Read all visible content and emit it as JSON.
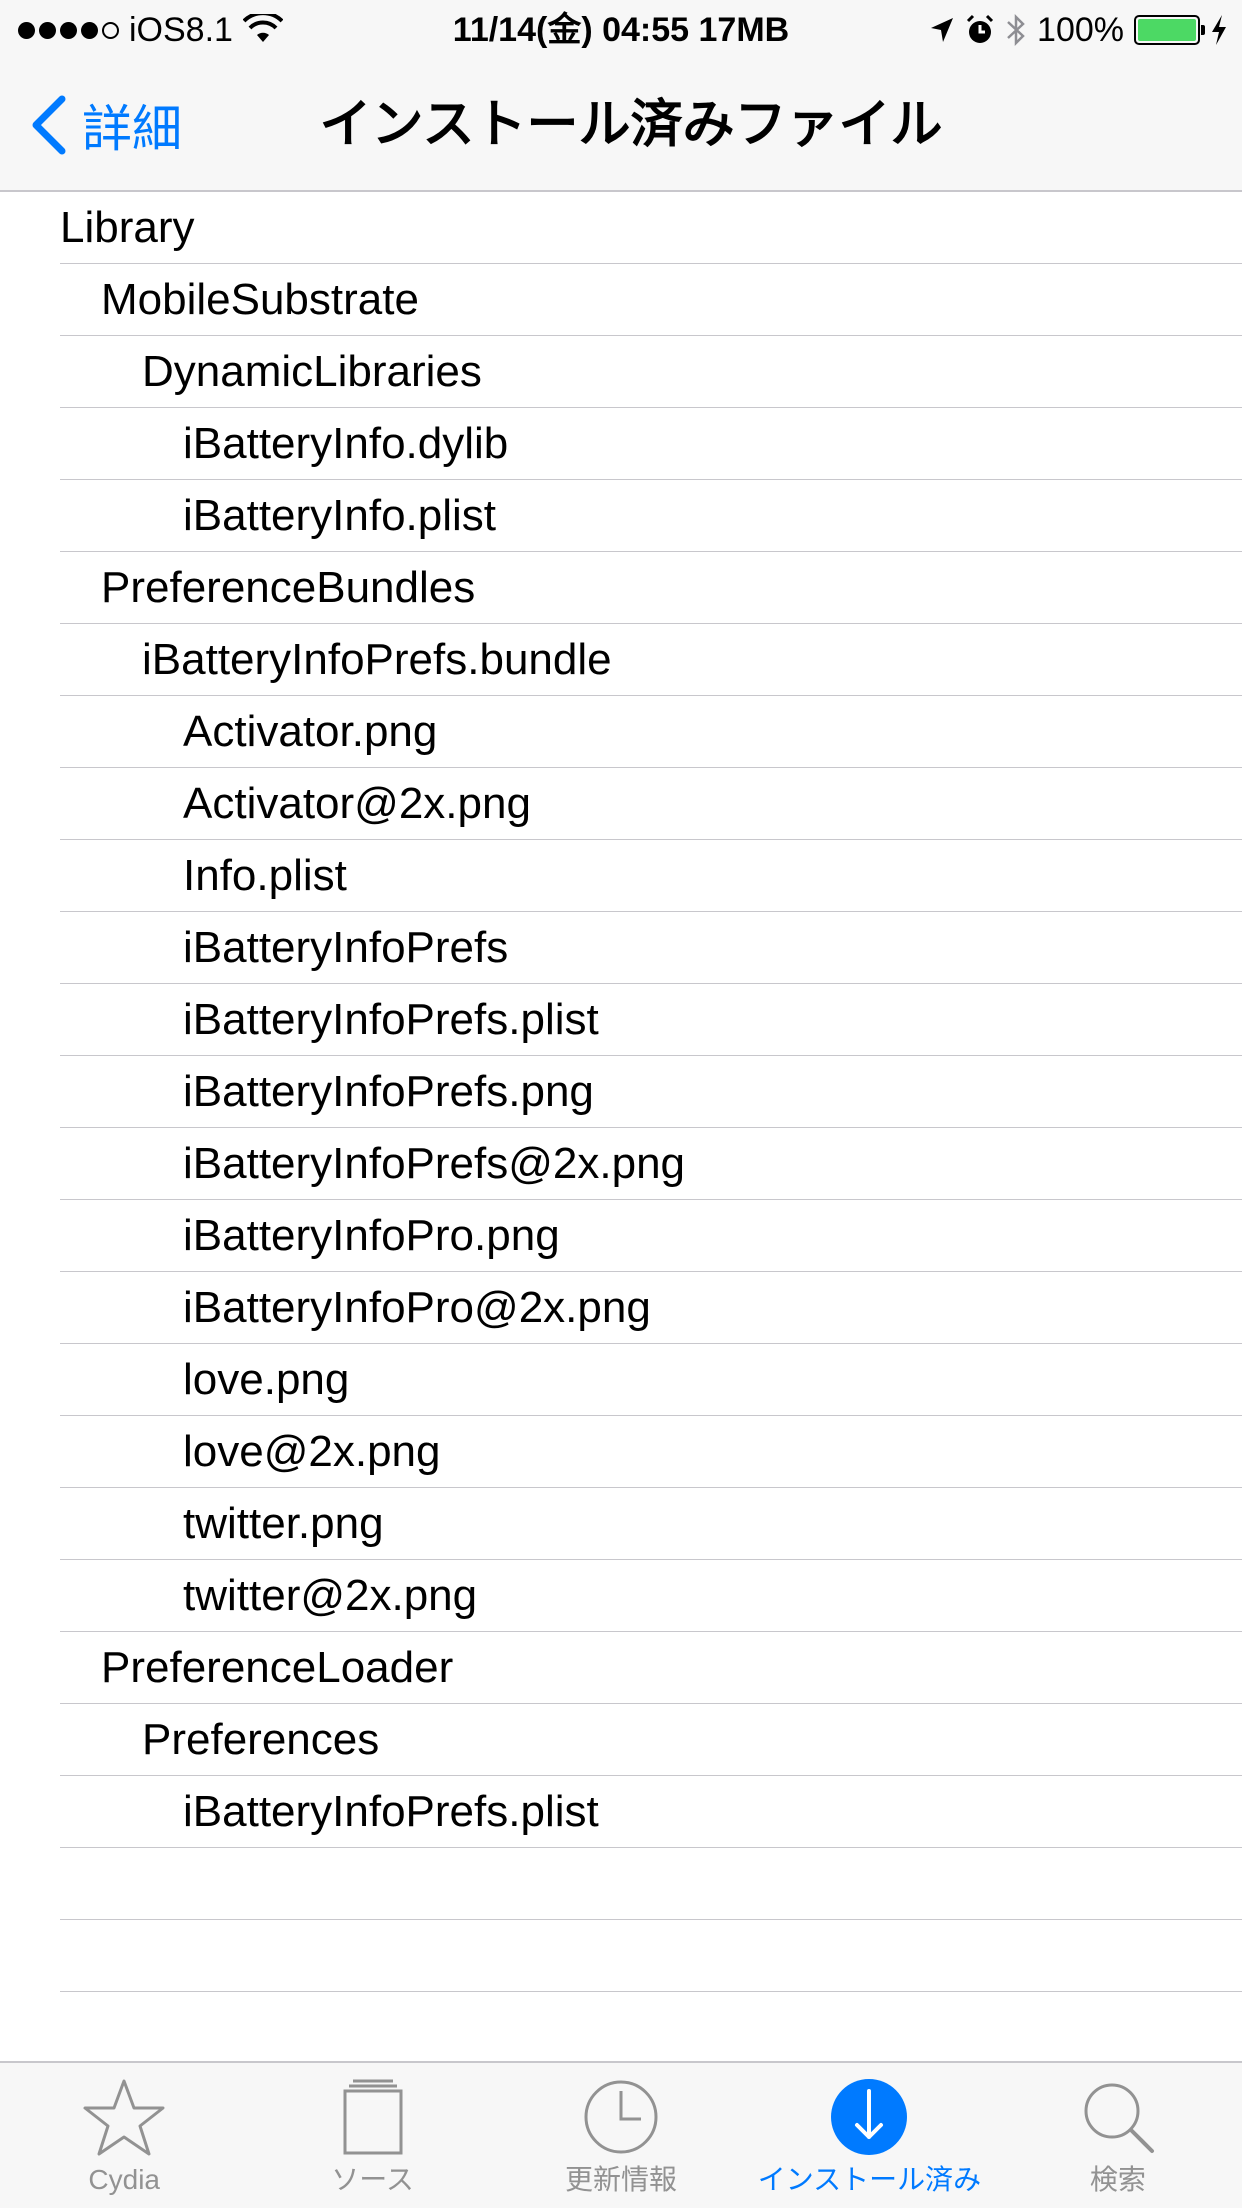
{
  "status_bar": {
    "carrier": "iOS8.1",
    "center_text": "11/14(金) 04:55 17MB",
    "battery_text": "100%",
    "battery_level": 1.0,
    "signal_bars_filled": 4,
    "signal_bars_total": 5
  },
  "nav": {
    "back_label": "詳細",
    "title": "インストール済みファイル"
  },
  "files": [
    {
      "name": "Library",
      "depth": 0
    },
    {
      "name": "MobileSubstrate",
      "depth": 1
    },
    {
      "name": "DynamicLibraries",
      "depth": 2
    },
    {
      "name": "iBatteryInfo.dylib",
      "depth": 3
    },
    {
      "name": "iBatteryInfo.plist",
      "depth": 3
    },
    {
      "name": "PreferenceBundles",
      "depth": 1
    },
    {
      "name": "iBatteryInfoPrefs.bundle",
      "depth": 2
    },
    {
      "name": "Activator.png",
      "depth": 3
    },
    {
      "name": "Activator@2x.png",
      "depth": 3
    },
    {
      "name": "Info.plist",
      "depth": 3
    },
    {
      "name": "iBatteryInfoPrefs",
      "depth": 3
    },
    {
      "name": "iBatteryInfoPrefs.plist",
      "depth": 3
    },
    {
      "name": "iBatteryInfoPrefs.png",
      "depth": 3
    },
    {
      "name": "iBatteryInfoPrefs@2x.png",
      "depth": 3
    },
    {
      "name": "iBatteryInfoPro.png",
      "depth": 3
    },
    {
      "name": "iBatteryInfoPro@2x.png",
      "depth": 3
    },
    {
      "name": "love.png",
      "depth": 3
    },
    {
      "name": "love@2x.png",
      "depth": 3
    },
    {
      "name": "twitter.png",
      "depth": 3
    },
    {
      "name": "twitter@2x.png",
      "depth": 3
    },
    {
      "name": "PreferenceLoader",
      "depth": 1
    },
    {
      "name": "Preferences",
      "depth": 2
    },
    {
      "name": "iBatteryInfoPrefs.plist",
      "depth": 3
    },
    {
      "name": "",
      "depth": 0
    },
    {
      "name": "",
      "depth": 0
    }
  ],
  "tabs": [
    {
      "label": "Cydia",
      "icon": "star-icon",
      "active": false
    },
    {
      "label": "ソース",
      "icon": "sources-icon",
      "active": false
    },
    {
      "label": "更新情報",
      "icon": "clock-icon",
      "active": false
    },
    {
      "label": "インストール済み",
      "icon": "download-icon",
      "active": true
    },
    {
      "label": "検索",
      "icon": "search-icon",
      "active": false
    }
  ],
  "colors": {
    "accent": "#007aff",
    "inactive_tab": "#929292",
    "battery_fill": "#4cd964",
    "separator": "#c8c7cc",
    "bar_background": "#f7f7f7"
  }
}
